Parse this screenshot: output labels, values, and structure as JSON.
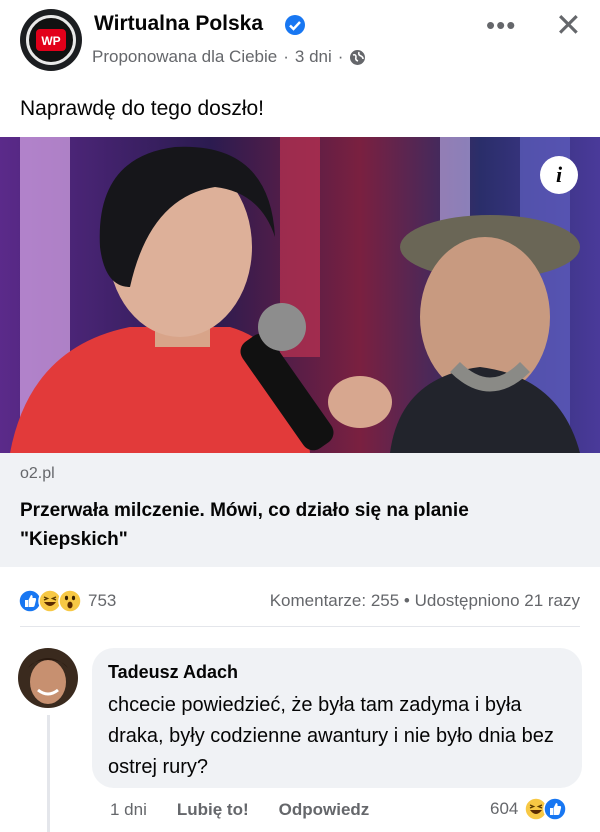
{
  "post": {
    "page_name": "Wirtualna Polska",
    "subtitle": "Proponowana dla Ciebie",
    "time": "3 dni",
    "separator": "·",
    "text": "Naprawdę do tego doszło!",
    "more_icon": "more-dots-icon",
    "close_icon": "close-icon",
    "info_label": "i"
  },
  "link": {
    "domain": "o2.pl",
    "title": "Przerwała milczenie. Mówi, co działo się na planie \"Kiepskich\""
  },
  "stats": {
    "reaction_count": "753",
    "comments": "Komentarze: 255",
    "dot": "•",
    "shares": "Udostępniono 21 razy"
  },
  "comment": {
    "author": "Tadeusz Adach",
    "text": "chcecie powiedzieć, że była tam zadyma i była draka, były codzienne awantury i nie było dnia bez ostrej rury?",
    "time": "1 dni",
    "like": "Lubię to!",
    "reply": "Odpowiedz",
    "reaction_count": "604"
  },
  "colors": {
    "brand_blue": "#1877f2",
    "muted": "#65676b",
    "bubble": "#f0f2f5"
  }
}
